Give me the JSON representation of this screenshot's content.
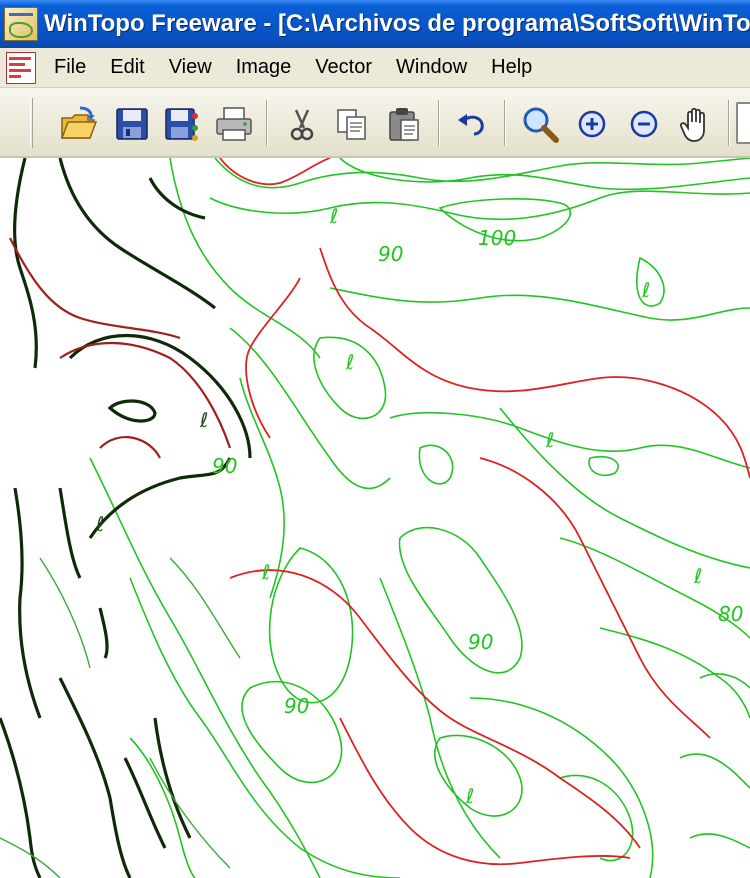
{
  "window": {
    "title": "WinTopo Freeware - [C:\\Archivos de programa\\SoftSoft\\WinTopo\\Sample.bmp]",
    "app_icon": "wintopo-app-icon"
  },
  "menubar": {
    "doc_icon": "document-map-icon",
    "items": [
      {
        "label": "File"
      },
      {
        "label": "Edit"
      },
      {
        "label": "View"
      },
      {
        "label": "Image"
      },
      {
        "label": "Vector"
      },
      {
        "label": "Window"
      },
      {
        "label": "Help"
      }
    ]
  },
  "toolbar": {
    "buttons": [
      {
        "name": "open",
        "icon": "open-folder-icon"
      },
      {
        "name": "save",
        "icon": "save-icon"
      },
      {
        "name": "save-as",
        "icon": "save-as-icon"
      },
      {
        "name": "print",
        "icon": "print-icon"
      },
      {
        "name": "cut",
        "icon": "scissors-icon"
      },
      {
        "name": "copy",
        "icon": "copy-icon"
      },
      {
        "name": "paste",
        "icon": "paste-icon"
      },
      {
        "name": "undo",
        "icon": "undo-icon"
      },
      {
        "name": "zoom",
        "icon": "magnifier-icon"
      },
      {
        "name": "zoom-in",
        "icon": "zoom-in-icon"
      },
      {
        "name": "zoom-out",
        "icon": "zoom-out-icon"
      },
      {
        "name": "pan",
        "icon": "hand-icon"
      }
    ]
  },
  "map": {
    "labels": [
      "90",
      "100",
      "90",
      "80",
      "90",
      "90"
    ],
    "small_marks": [
      "ℓ",
      "ℓ",
      "ℓ",
      "ℓ",
      "ℓ",
      "ℓ",
      "ℓ",
      "ℓ",
      "ℓ"
    ],
    "colors": {
      "contour_green": "#22c422",
      "contour_red": "#dd2222",
      "raster_dark": "#0f2a08",
      "background": "#ffffff"
    }
  }
}
